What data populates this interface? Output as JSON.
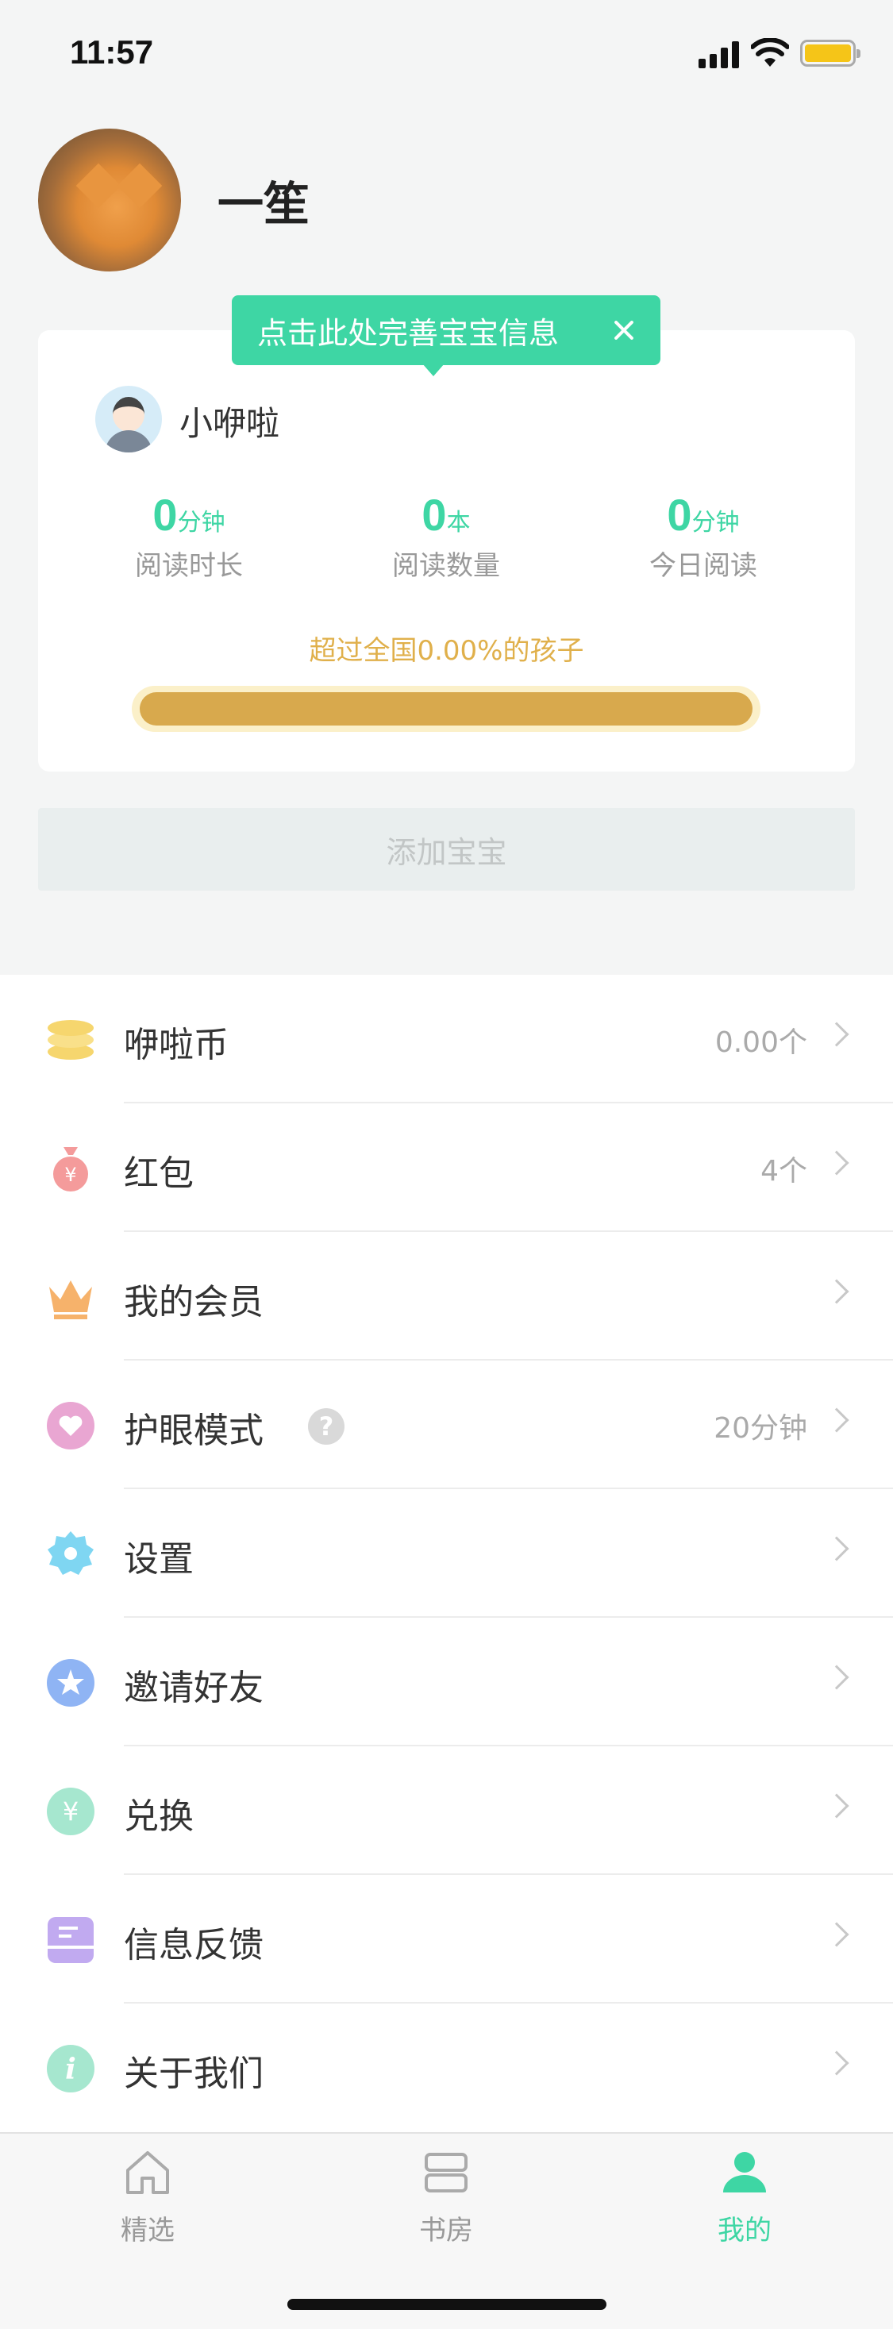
{
  "status_bar": {
    "time": "11:57"
  },
  "profile": {
    "name": "一笙"
  },
  "tooltip": {
    "text": "点击此处完善宝宝信息"
  },
  "baby": {
    "name": "小咿啦"
  },
  "stats": [
    {
      "value": "0",
      "unit": "分钟",
      "label": "阅读时长"
    },
    {
      "value": "0",
      "unit": "本",
      "label": "阅读数量"
    },
    {
      "value": "0",
      "unit": "分钟",
      "label": "今日阅读"
    }
  ],
  "rank": {
    "text": "超过全国0.00%的孩子",
    "fill_fraction": 1.0
  },
  "add_baby": {
    "label": "添加宝宝"
  },
  "menu": [
    {
      "label": "咿啦币",
      "value": "0.00个",
      "icon": "coins-icon",
      "color": "#f6d66e"
    },
    {
      "label": "红包",
      "value": "4个",
      "icon": "money-bag-icon",
      "color": "#f49b9b"
    },
    {
      "label": "我的会员",
      "value": "",
      "icon": "crown-icon",
      "color": "#f6b26b"
    },
    {
      "label": "护眼模式",
      "value": "20分钟",
      "icon": "heart-icon",
      "color": "#e9a6d2",
      "help": "?"
    },
    {
      "label": "设置",
      "value": "",
      "icon": "gear-icon",
      "color": "#7fd6f2"
    },
    {
      "label": "邀请好友",
      "value": "",
      "icon": "star-icon",
      "color": "#8fb4f4"
    },
    {
      "label": "兑换",
      "value": "",
      "icon": "yen-icon",
      "color": "#8fe0c4"
    },
    {
      "label": "信息反馈",
      "value": "",
      "icon": "feedback-icon",
      "color": "#c1aaf0"
    },
    {
      "label": "关于我们",
      "value": "",
      "icon": "info-icon",
      "color": "#a6e7cf"
    }
  ],
  "tabs": [
    {
      "label": "精选",
      "icon": "home-icon",
      "active": false
    },
    {
      "label": "书房",
      "icon": "bookshelf-icon",
      "active": false
    },
    {
      "label": "我的",
      "icon": "profile-icon",
      "active": true
    }
  ],
  "colors": {
    "accent": "#3ed6a4",
    "gold": "#d8a94d"
  }
}
